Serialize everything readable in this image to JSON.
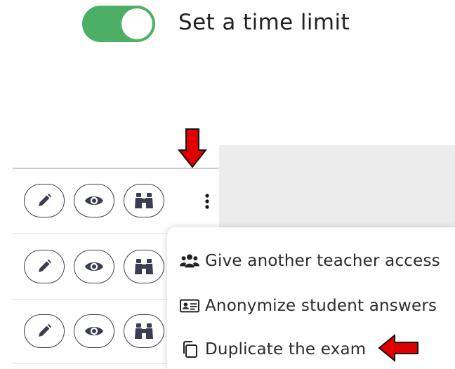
{
  "time_limit": {
    "label": "Set a time limit",
    "enabled": true,
    "toggle_color": "#4caf65"
  },
  "rows": [
    {
      "actions": [
        "edit-icon",
        "view-icon",
        "binoculars-icon"
      ],
      "has_more_menu": true
    },
    {
      "actions": [
        "edit-icon",
        "view-icon",
        "binoculars-icon"
      ],
      "has_more_menu": false
    },
    {
      "actions": [
        "edit-icon",
        "view-icon",
        "binoculars-icon"
      ],
      "has_more_menu": false
    }
  ],
  "menu": {
    "items": [
      {
        "label": "Give another teacher access",
        "icon": "users-icon"
      },
      {
        "label": "Anonymize student answers",
        "icon": "id-card-icon"
      },
      {
        "label": "Duplicate the exam",
        "icon": "copy-icon"
      }
    ]
  },
  "annotation_color": "#e00000"
}
